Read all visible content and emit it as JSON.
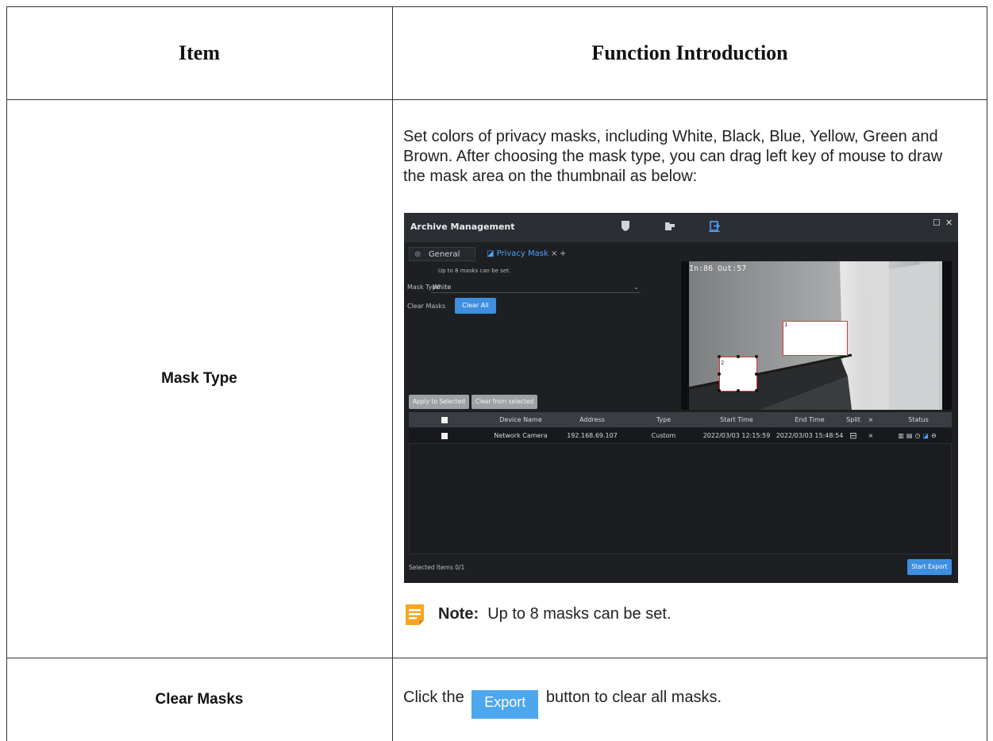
{
  "table": {
    "header_item": "Item",
    "header_function": "Function Introduction"
  },
  "rows": [
    {
      "item": "Mask Type",
      "description": "Set colors of privacy masks, including White, Black, Blue, Yellow, Green and Brown. After choosing the mask type, you can drag left key of mouse to draw the mask area on the thumbnail as below:",
      "note_label": "Note:",
      "note_text": "Up to 8 masks can be set."
    },
    {
      "item": "Clear Masks",
      "text_before": "Click the",
      "button_label": "Export",
      "text_after": "button to clear all masks."
    }
  ],
  "screenshot": {
    "window_title": "Archive Management",
    "window_buttons": [
      "☐",
      "✕"
    ],
    "tabs": [
      {
        "icon": "gear-icon",
        "label": "General"
      },
      {
        "icon": "privacy-mask-icon",
        "label": "Privacy Mask",
        "close": "×"
      }
    ],
    "add_tab": "+",
    "hint": "Up to 8 masks can be set.",
    "mask_type_label": "Mask Type",
    "mask_type_value": "White",
    "clear_masks_label": "Clear Masks",
    "clear_all_button": "Clear All",
    "apply_button": "Apply to Selected",
    "clear_selected_button": "Clear from selected",
    "thumbnail_osd": "In:86 Out:57",
    "mask_labels": [
      "1",
      "2"
    ],
    "columns": [
      "Device Name",
      "Address",
      "Type",
      "Start Time",
      "End Time",
      "Split",
      "×",
      "Status"
    ],
    "rows": [
      {
        "device": "Network Camera",
        "address": "192.168.69.107",
        "type": "Custom",
        "start": "2022/03/03 12:15:59",
        "end": "2022/03/03 15:48:54",
        "close": "×"
      }
    ],
    "selected_items": "Selected Items  0/1",
    "start_export_button": "Start Export"
  },
  "colors": {
    "accent_blue": "#3e8fe0",
    "note_icon": "#f0a030",
    "dark_bg": "#1d1f23"
  }
}
